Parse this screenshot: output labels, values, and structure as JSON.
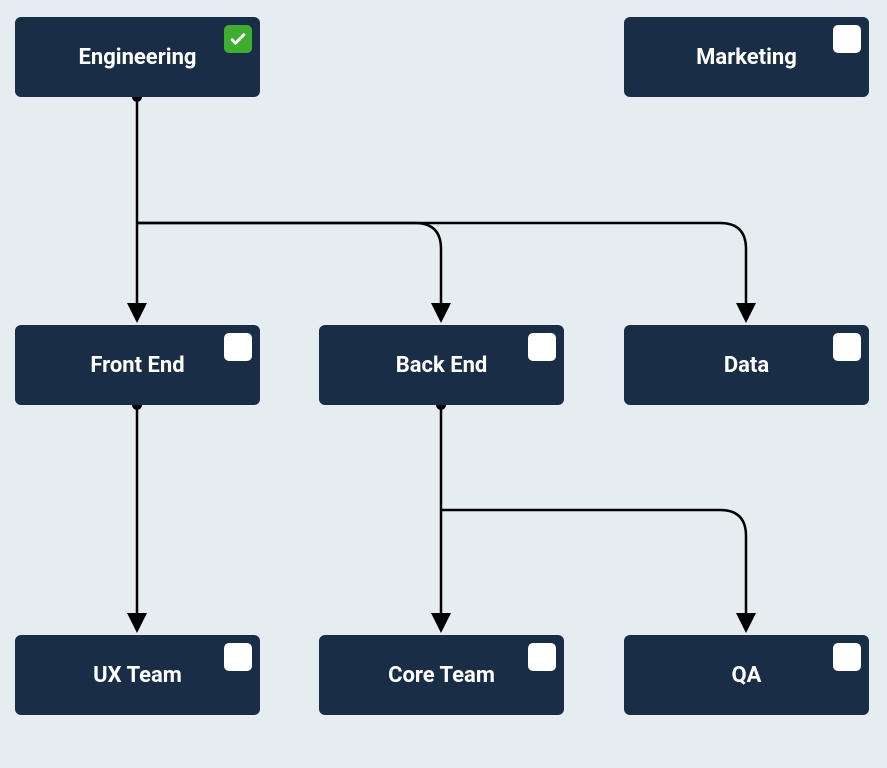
{
  "nodes": {
    "engineering": {
      "label": "Engineering",
      "checked": true
    },
    "marketing": {
      "label": "Marketing",
      "checked": false
    },
    "frontend": {
      "label": "Front End",
      "checked": false
    },
    "backend": {
      "label": "Back End",
      "checked": false
    },
    "data": {
      "label": "Data",
      "checked": false
    },
    "uxteam": {
      "label": "UX Team",
      "checked": false
    },
    "coreteam": {
      "label": "Core Team",
      "checked": false
    },
    "qa": {
      "label": "QA",
      "checked": false
    }
  },
  "edges": [
    {
      "from": "engineering",
      "to": "frontend"
    },
    {
      "from": "engineering",
      "to": "backend"
    },
    {
      "from": "engineering",
      "to": "data"
    },
    {
      "from": "frontend",
      "to": "uxteam"
    },
    {
      "from": "backend",
      "to": "coreteam"
    },
    {
      "from": "backend",
      "to": "qa"
    }
  ],
  "colors": {
    "background": "#e5edf0",
    "node": "#1a2d47",
    "checked": "#3fad2f",
    "edge": "#000000"
  }
}
